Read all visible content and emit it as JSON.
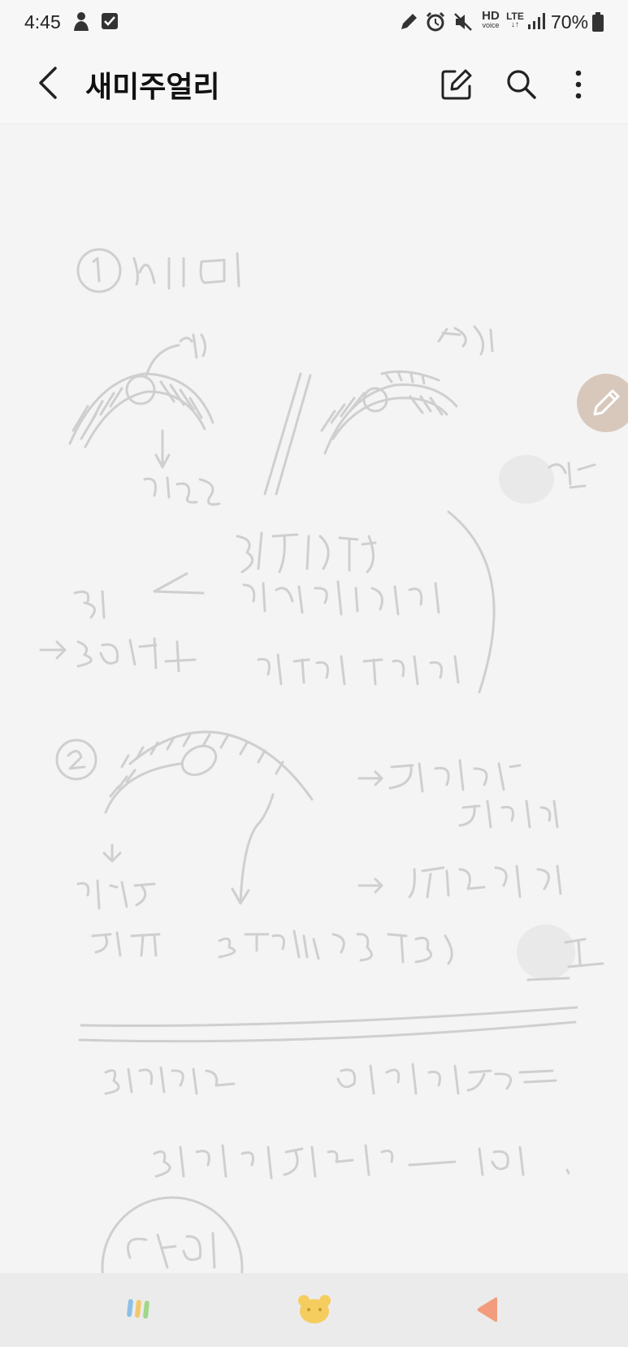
{
  "status_bar": {
    "time": "4:45",
    "network_hd": "HD",
    "network_voice": "voice",
    "network_lte": "LTE",
    "battery": "70%"
  },
  "app_bar": {
    "title": "새미주얼리",
    "icons": [
      "back-icon",
      "edit-icon",
      "search-icon",
      "more-icon"
    ]
  },
  "note": {
    "handwriting_color": "#cccccc",
    "float_pen_color": "#d8c8bc"
  },
  "bottom_nav": {
    "items": [
      "pastel-lines-icon",
      "bear-icon",
      "triangle-icon"
    ]
  }
}
